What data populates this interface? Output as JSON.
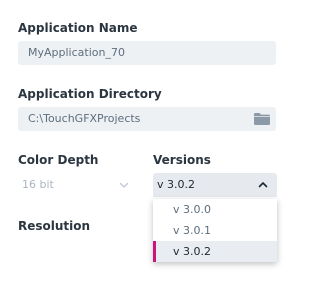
{
  "app_name": {
    "label": "Application Name",
    "value": "MyApplication_70"
  },
  "app_directory": {
    "label": "Application Directory",
    "value": "C:\\TouchGFXProjects",
    "icon": "folder-icon"
  },
  "color_depth": {
    "label": "Color Depth",
    "value": "16 bit",
    "icon": "chevron-down-icon"
  },
  "versions": {
    "label": "Versions",
    "value": "v 3.0.2",
    "icon": "chevron-up-icon",
    "options": [
      "v 3.0.0",
      "v 3.0.1",
      "v 3.0.2"
    ],
    "accent_color": "#c8177a"
  },
  "resolution": {
    "label": "Resolution"
  }
}
